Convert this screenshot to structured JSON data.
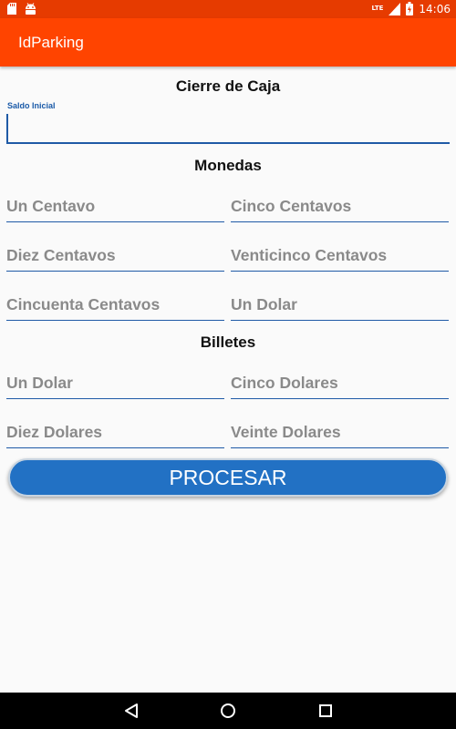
{
  "status_bar": {
    "time": "14:06",
    "network": "LTE",
    "icons": [
      "sd-card-icon",
      "android-icon",
      "signal-icon",
      "battery-icon"
    ]
  },
  "app_bar": {
    "title": "IdParking"
  },
  "form": {
    "title": "Cierre de Caja",
    "saldo_label": "Saldo Inicial",
    "saldo_value": "",
    "monedas_heading": "Monedas",
    "monedas": [
      "Un Centavo",
      "Cinco Centavos",
      "Diez Centavos",
      "Venticinco Centavos",
      "Cincuenta Centavos",
      "Un Dolar"
    ],
    "billetes_heading": "Billetes",
    "billetes": [
      "Un Dolar",
      "Cinco Dolares",
      "Diez Dolares",
      "Veinte Dolares"
    ],
    "submit_label": "PROCESAR"
  },
  "nav": {
    "icons": [
      "back-icon",
      "home-icon",
      "recents-icon"
    ]
  },
  "colors": {
    "app_bar": "#ff4400",
    "status_bar": "#e63b00",
    "accent": "#1f5aa6",
    "button": "#2271c4",
    "hint": "#8a8a8a"
  }
}
